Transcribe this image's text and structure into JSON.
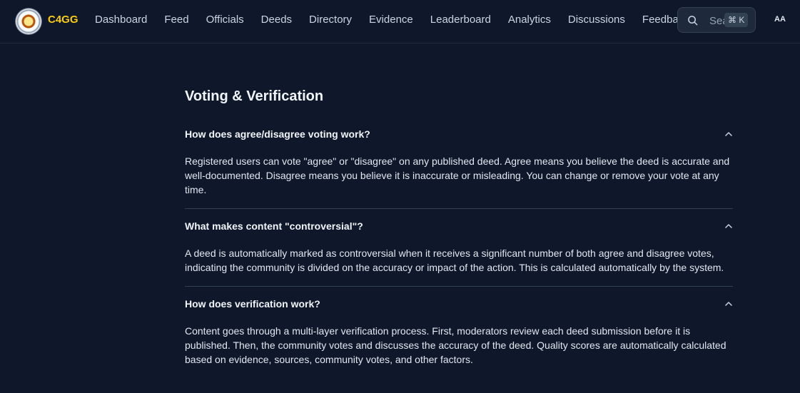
{
  "brand": {
    "name": "C4GG"
  },
  "nav": [
    "Dashboard",
    "Feed",
    "Officials",
    "Deeds",
    "Directory",
    "Evidence",
    "Leaderboard",
    "Analytics",
    "Discussions",
    "Feedback"
  ],
  "search": {
    "placeholder": "Sea",
    "shortcut": "⌘ K"
  },
  "text_size_toggle": "AA",
  "section": {
    "title": "Voting & Verification"
  },
  "faqs": [
    {
      "question": "How does agree/disagree voting work?",
      "answer": "Registered users can vote \"agree\" or \"disagree\" on any published deed. Agree means you believe the deed is accurate and well-documented. Disagree means you believe it is inaccurate or misleading. You can change or remove your vote at any time."
    },
    {
      "question": "What makes content \"controversial\"?",
      "answer": "A deed is automatically marked as controversial when it receives a significant number of both agree and disagree votes, indicating the community is divided on the accuracy or impact of the action. This is calculated automatically by the system."
    },
    {
      "question": "How does verification work?",
      "answer": "Content goes through a multi-layer verification process. First, moderators review each deed submission before it is published. Then, the community votes and discusses the accuracy of the deed. Quality scores are automatically calculated based on evidence, sources, community votes, and other factors."
    }
  ],
  "icons": {
    "search": "search-icon",
    "chevron": "chevron-up-icon",
    "logo": "seal-logo"
  },
  "colors": {
    "background": "#0f172a",
    "brand": "#facc15",
    "text": "#e2e8f0"
  }
}
